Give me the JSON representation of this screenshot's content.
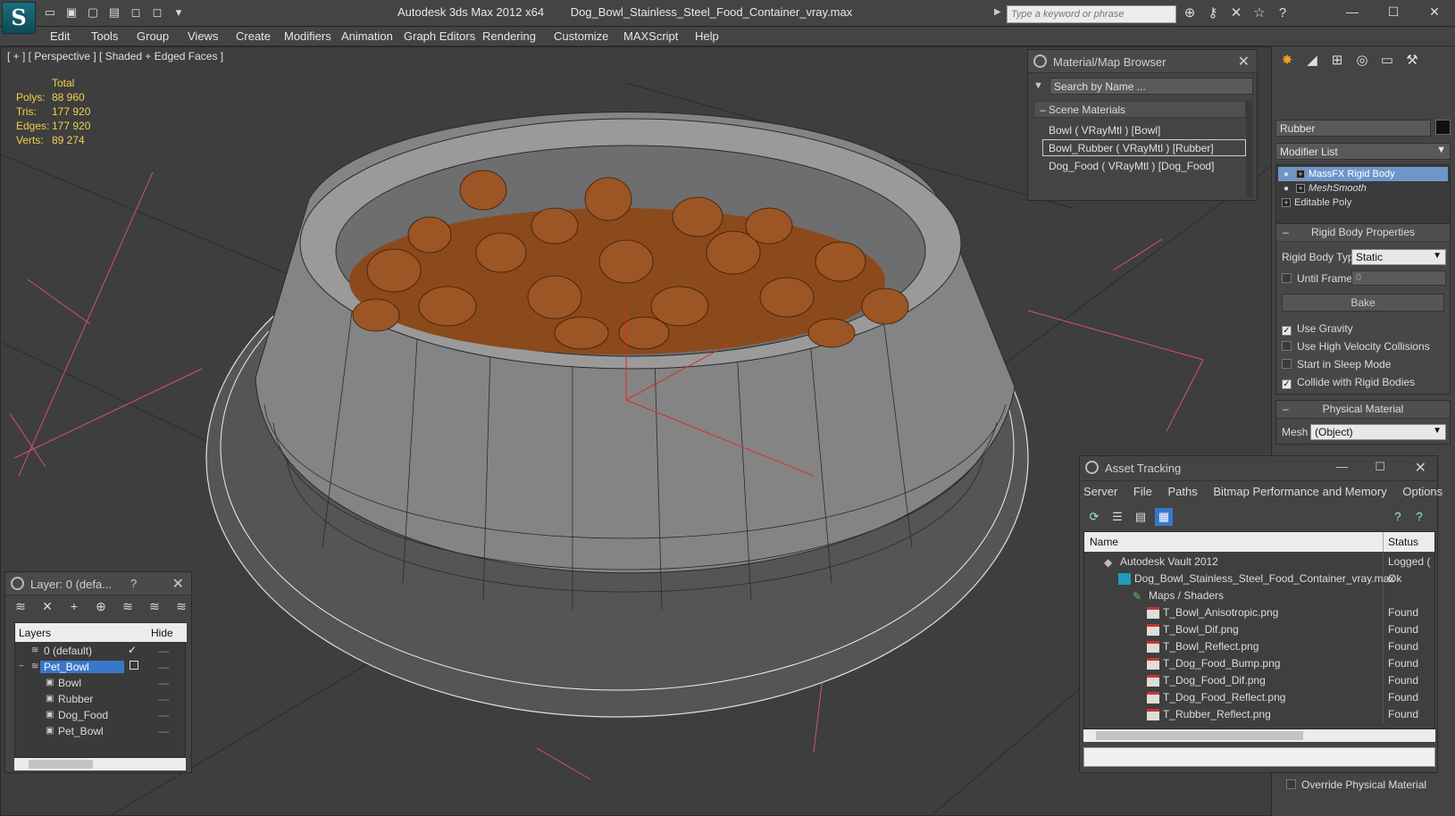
{
  "window": {
    "app_title": "Autodesk 3ds Max  2012 x64",
    "file_title": "Dog_Bowl_Stainless_Steel_Food_Container_vray.max",
    "search_placeholder": "Type a keyword or phrase",
    "controls": {
      "minimize": "—",
      "maximize": "☐",
      "close": "✕"
    }
  },
  "menu": [
    "Edit",
    "Tools",
    "Group",
    "Views",
    "Create",
    "Modifiers",
    "Animation",
    "Graph Editors",
    "Rendering",
    "Customize",
    "MAXScript",
    "Help"
  ],
  "viewport": {
    "label": "[ + ] [ Perspective ] [ Shaded + Edged Faces ]",
    "stats_header": "Total",
    "stats": [
      {
        "key": "Polys:",
        "value": "88 960"
      },
      {
        "key": "Tris:",
        "value": "177 920"
      },
      {
        "key": "Edges:",
        "value": "177 920"
      },
      {
        "key": "Verts:",
        "value": "89 274"
      }
    ],
    "colors": {
      "background": "#3e3e3e",
      "grid": "#2c2c2c",
      "accent_lines": "#d4507a",
      "bowl": "#8a8a8a",
      "food": "#8b4a1c"
    }
  },
  "material_browser": {
    "title": "Material/Map Browser",
    "search_placeholder": "Search by Name ...",
    "group": "Scene Materials",
    "items": [
      {
        "label": "Bowl  ( VRayMtl ) [Bowl]",
        "selected": false
      },
      {
        "label": "Bowl_Rubber  ( VRayMtl ) [Rubber]",
        "selected": true
      },
      {
        "label": "Dog_Food  ( VRayMtl ) [Dog_Food]",
        "selected": false
      }
    ]
  },
  "command_panel": {
    "object_name": "Rubber",
    "modifier_list": "Modifier List",
    "stack": [
      {
        "label": "MassFX Rigid Body",
        "selected": true
      },
      {
        "label": "MeshSmooth",
        "selected": false
      },
      {
        "label": "Editable Poly",
        "selected": false
      }
    ],
    "rigid_body": {
      "title": "Rigid Body Properties",
      "type_label": "Rigid Body Type",
      "type_value": "Static",
      "until_frame_label": "Until Frame",
      "until_frame_value": "0",
      "bake_label": "Bake",
      "options": [
        {
          "label": "Use Gravity",
          "checked": true
        },
        {
          "label": "Use High Velocity Collisions",
          "checked": false
        },
        {
          "label": "Start in Sleep Mode",
          "checked": false
        },
        {
          "label": "Collide with Rigid Bodies",
          "checked": true
        }
      ]
    },
    "physical_material": {
      "title": "Physical Material",
      "mesh_label": "Mesh",
      "mesh_value": "(Object)"
    },
    "override_label": "Override Physical Material"
  },
  "asset_tracking": {
    "title": "Asset Tracking",
    "menu": [
      "Server",
      "File",
      "Paths",
      "Bitmap Performance and Memory",
      "Options"
    ],
    "columns": {
      "name": "Name",
      "status": "Status"
    },
    "rows": [
      {
        "name": "Autodesk Vault 2012",
        "status": "Logged (",
        "indent": 1,
        "icon": "vault-icon"
      },
      {
        "name": "Dog_Bowl_Stainless_Steel_Food_Container_vray.max",
        "status": "Ok",
        "indent": 2,
        "icon": "max-file-icon"
      },
      {
        "name": "Maps / Shaders",
        "status": "",
        "indent": 3,
        "icon": "maps-icon"
      },
      {
        "name": "T_Bowl_Anisotropic.png",
        "status": "Found",
        "indent": 4,
        "icon": "png-icon"
      },
      {
        "name": "T_Bowl_Dif.png",
        "status": "Found",
        "indent": 4,
        "icon": "png-icon"
      },
      {
        "name": "T_Bowl_Reflect.png",
        "status": "Found",
        "indent": 4,
        "icon": "png-icon"
      },
      {
        "name": "T_Dog_Food_Bump.png",
        "status": "Found",
        "indent": 4,
        "icon": "png-icon"
      },
      {
        "name": "T_Dog_Food_Dif.png",
        "status": "Found",
        "indent": 4,
        "icon": "png-icon"
      },
      {
        "name": "T_Dog_Food_Reflect.png",
        "status": "Found",
        "indent": 4,
        "icon": "png-icon"
      },
      {
        "name": "T_Rubber_Reflect.png",
        "status": "Found",
        "indent": 4,
        "icon": "png-icon"
      }
    ]
  },
  "layer_manager": {
    "title": "Layer: 0 (defa...",
    "help": "?",
    "columns": {
      "layers": "Layers",
      "hide": "Hide"
    },
    "rows": [
      {
        "name": "0 (default)",
        "level": 0,
        "active": true,
        "selected": false
      },
      {
        "name": "Pet_Bowl",
        "level": 0,
        "active": false,
        "selected": true
      },
      {
        "name": "Bowl",
        "level": 1,
        "active": false,
        "selected": false
      },
      {
        "name": "Rubber",
        "level": 1,
        "active": false,
        "selected": false
      },
      {
        "name": "Dog_Food",
        "level": 1,
        "active": false,
        "selected": false
      },
      {
        "name": "Pet_Bowl",
        "level": 1,
        "active": false,
        "selected": false
      }
    ]
  }
}
